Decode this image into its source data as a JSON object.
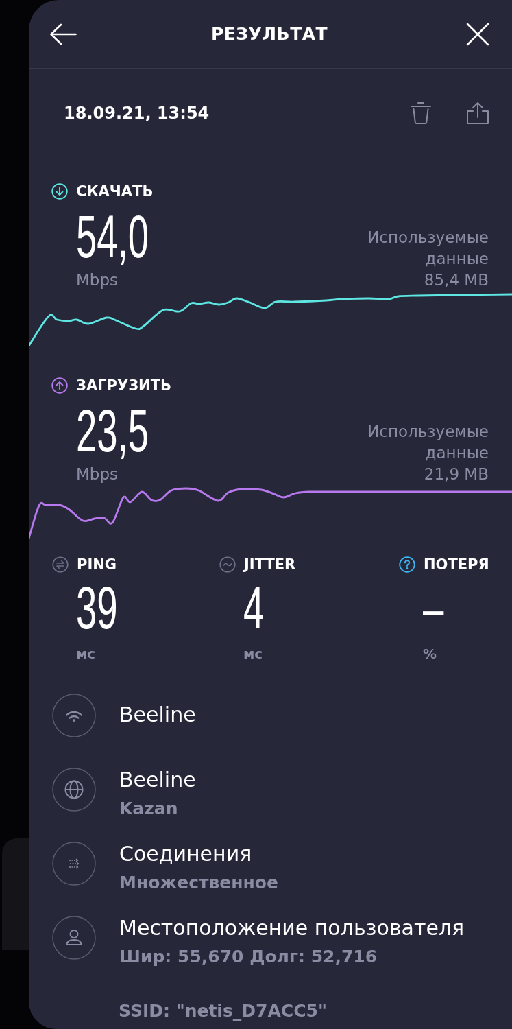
{
  "header": {
    "title": "РЕЗУЛЬТАТ"
  },
  "date": "18.09.21, 13:54",
  "speed_tests": [
    {
      "kind": "download",
      "label": "СКАЧАТЬ",
      "value": "54,0",
      "unit": "Mbps",
      "data_label": "Используемые данные",
      "data_value": "85,4 MB",
      "color": "#5ee6e2"
    },
    {
      "kind": "upload",
      "label": "ЗАГРУЗИТЬ",
      "value": "23,5",
      "unit": "Mbps",
      "data_label": "Используемые данные",
      "data_value": "21,9 MB",
      "color": "#b878ee"
    }
  ],
  "stats": [
    {
      "kind": "ping",
      "label": "PING",
      "value": "39",
      "unit": "мс"
    },
    {
      "kind": "jitter",
      "label": "JITTER",
      "value": "4",
      "unit": "мс"
    },
    {
      "kind": "loss",
      "label": "ПОТЕРЯ",
      "value": "–",
      "unit": "%"
    }
  ],
  "info": [
    {
      "kind": "network",
      "title": "Beeline"
    },
    {
      "kind": "server",
      "title": "Beeline",
      "subtitle": "Kazan"
    },
    {
      "kind": "connections",
      "title": "Соединения",
      "subtitle": "Множественное"
    },
    {
      "kind": "location",
      "title": "Местоположение пользователя",
      "subtitle": "Шир: 55,670 Долг: 52,716"
    }
  ],
  "ssid": "SSID: \"netis_D7ACC5\""
}
